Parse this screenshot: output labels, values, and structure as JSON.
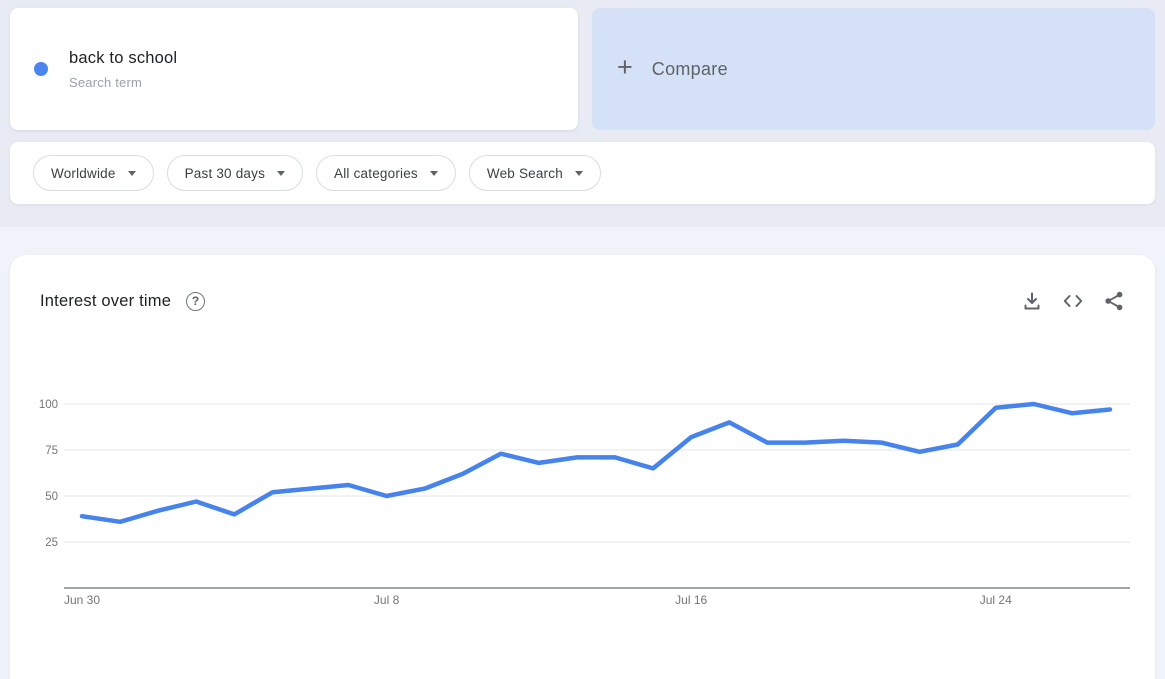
{
  "term_card": {
    "term": "back to school",
    "type_label": "Search term"
  },
  "compare_card": {
    "plus": "+",
    "label": "Compare"
  },
  "filters": [
    {
      "label": "Worldwide"
    },
    {
      "label": "Past 30 days"
    },
    {
      "label": "All categories"
    },
    {
      "label": "Web Search"
    }
  ],
  "chart_section": {
    "title": "Interest over time",
    "help": "?",
    "icons": [
      "download-icon",
      "embed-icon",
      "share-icon"
    ]
  },
  "colors": {
    "line_blue": "#4683ec",
    "dot_blue": "#4c84ee",
    "compare_bg": "#d4e1f6",
    "grid": "#e6e6e6",
    "baseline": "#83878c",
    "axis_text": "#757575"
  },
  "chart_data": {
    "type": "line",
    "title": "Interest over time",
    "x": [
      "Jun 30",
      "Jul 1",
      "Jul 2",
      "Jul 3",
      "Jul 4",
      "Jul 5",
      "Jul 6",
      "Jul 7",
      "Jul 8",
      "Jul 9",
      "Jul 10",
      "Jul 11",
      "Jul 12",
      "Jul 13",
      "Jul 14",
      "Jul 15",
      "Jul 16",
      "Jul 17",
      "Jul 18",
      "Jul 19",
      "Jul 20",
      "Jul 21",
      "Jul 22",
      "Jul 23",
      "Jul 24",
      "Jul 25",
      "Jul 26",
      "Jul 27"
    ],
    "values": [
      39,
      36,
      42,
      47,
      40,
      52,
      54,
      56,
      50,
      54,
      62,
      73,
      68,
      71,
      71,
      65,
      82,
      90,
      79,
      79,
      80,
      79,
      74,
      78,
      98,
      100,
      95,
      97
    ],
    "x_tick_labels": [
      "Jun 30",
      "Jul 8",
      "Jul 16",
      "Jul 24"
    ],
    "y_ticks": [
      25,
      50,
      75,
      100
    ],
    "ylim": [
      0,
      100
    ],
    "grid": true,
    "legend": "none",
    "xlabel": "",
    "ylabel": ""
  }
}
